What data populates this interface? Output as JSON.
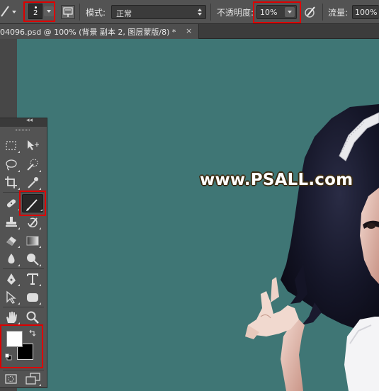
{
  "options_bar": {
    "brush_size": "2",
    "mode_label": "模式:",
    "mode_value": "正常",
    "opacity_label": "不透明度:",
    "opacity_value": "10%",
    "flow_label": "流量:",
    "flow_value": "100%"
  },
  "document_tab": {
    "title": "04096.psd @ 100% (背景 副本 2, 图层蒙版/8) *",
    "close": "×"
  },
  "canvas": {
    "background": "#3f7675",
    "watermark": "www.PSALL.com"
  },
  "toolbox": {
    "collapse": "◂◂",
    "tools": [
      "rect-marquee",
      "move",
      "lasso",
      "quick-selection",
      "crop",
      "eyedropper",
      "healing-brush",
      "brush",
      "clone-stamp",
      "history-brush",
      "eraser",
      "gradient",
      "blur",
      "dodge",
      "pen",
      "type",
      "path-selection",
      "rounded-rectangle",
      "hand",
      "zoom"
    ],
    "active_tool": "brush",
    "foreground_color": "#ffffff",
    "background_color": "#000000"
  },
  "highlight_color": "#dd0000"
}
